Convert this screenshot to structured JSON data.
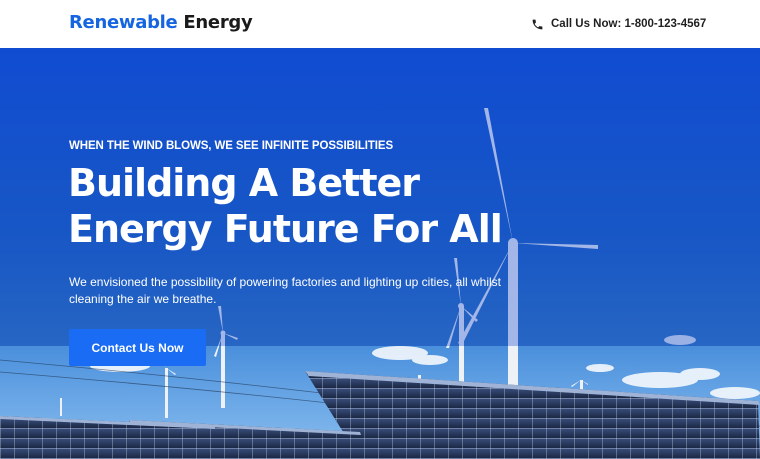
{
  "header": {
    "brand_part1": "Renewable",
    "brand_part2": "Energy",
    "phone_label": "Call Us Now: 1-800-123-4567",
    "phone_icon": "phone-icon"
  },
  "hero": {
    "tagline": "WHEN THE WIND BLOWS, WE SEE INFINITE POSSIBILITIES",
    "headline_line1": "Building A Better",
    "headline_line2": "Energy Future For All",
    "description": "We envisioned the possibility of powering factories and lighting up cities, all whilst cleaning the air we breathe.",
    "cta_label": "Contact Us Now",
    "background_image": "wind turbines and solar panels under blue sky"
  },
  "colors": {
    "brand_blue": "#1565e0",
    "cta_blue": "#1a6cf5",
    "hero_overlay": "#1448c8"
  }
}
